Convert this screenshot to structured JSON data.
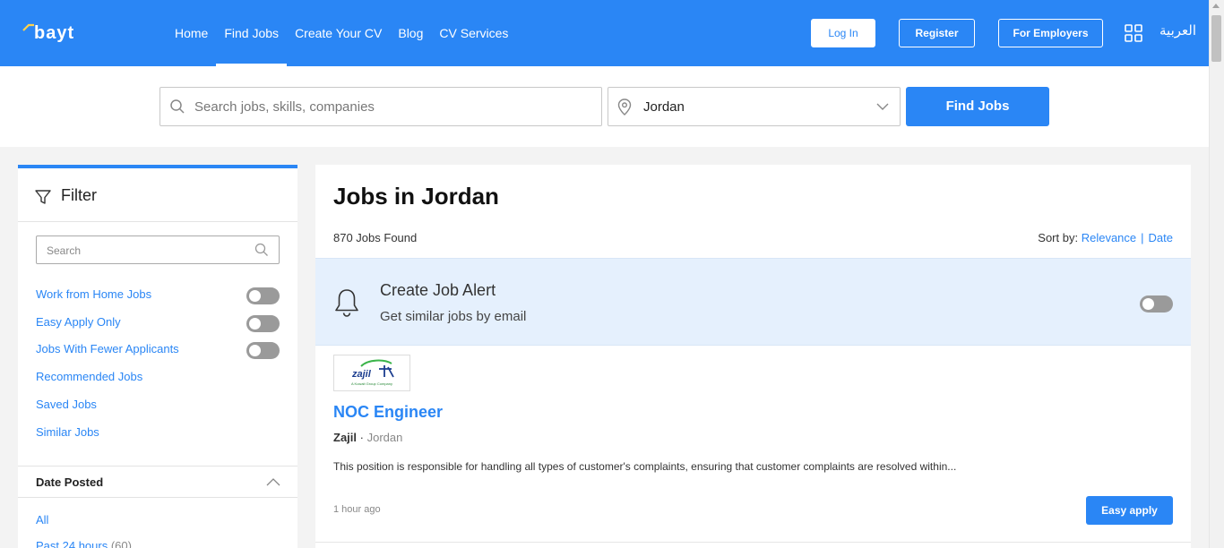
{
  "header": {
    "brand_color": "#2a86f5",
    "nav": [
      "Home",
      "Find Jobs",
      "Create Your CV",
      "Blog",
      "CV Services"
    ],
    "active_nav": "Find Jobs",
    "login": "Log In",
    "register": "Register",
    "employers": "For Employers",
    "language": "العربية"
  },
  "search": {
    "placeholder": "Search jobs, skills, companies",
    "location": "Jordan",
    "button": "Find Jobs"
  },
  "filter": {
    "title": "Filter",
    "search_placeholder": "Search",
    "toggles": [
      "Work from Home Jobs",
      "Easy Apply Only",
      "Jobs With Fewer Applicants"
    ],
    "links": [
      "Recommended Jobs",
      "Saved Jobs",
      "Similar Jobs"
    ],
    "date_posted": {
      "title": "Date Posted",
      "options": [
        {
          "label": "All",
          "count": ""
        },
        {
          "label": "Past 24 hours",
          "count": "(60)"
        }
      ]
    }
  },
  "main": {
    "title": "Jobs in Jordan",
    "jobs_found": "870 Jobs Found",
    "sort_label": "Sort by:",
    "sort_options": [
      "Relevance",
      "Date"
    ],
    "alert": {
      "title": "Create Job Alert",
      "subtitle": "Get similar jobs by email"
    },
    "job": {
      "logo_text": "zajil",
      "logo_sub": "A Kuwait Group Company",
      "title": "NOC Engineer",
      "company": "Zajil",
      "location": "Jordan",
      "description": "This position is responsible for handling all types of customer's complaints, ensuring that customer complaints are resolved within...",
      "posted": "1 hour ago",
      "apply": "Easy apply"
    }
  }
}
